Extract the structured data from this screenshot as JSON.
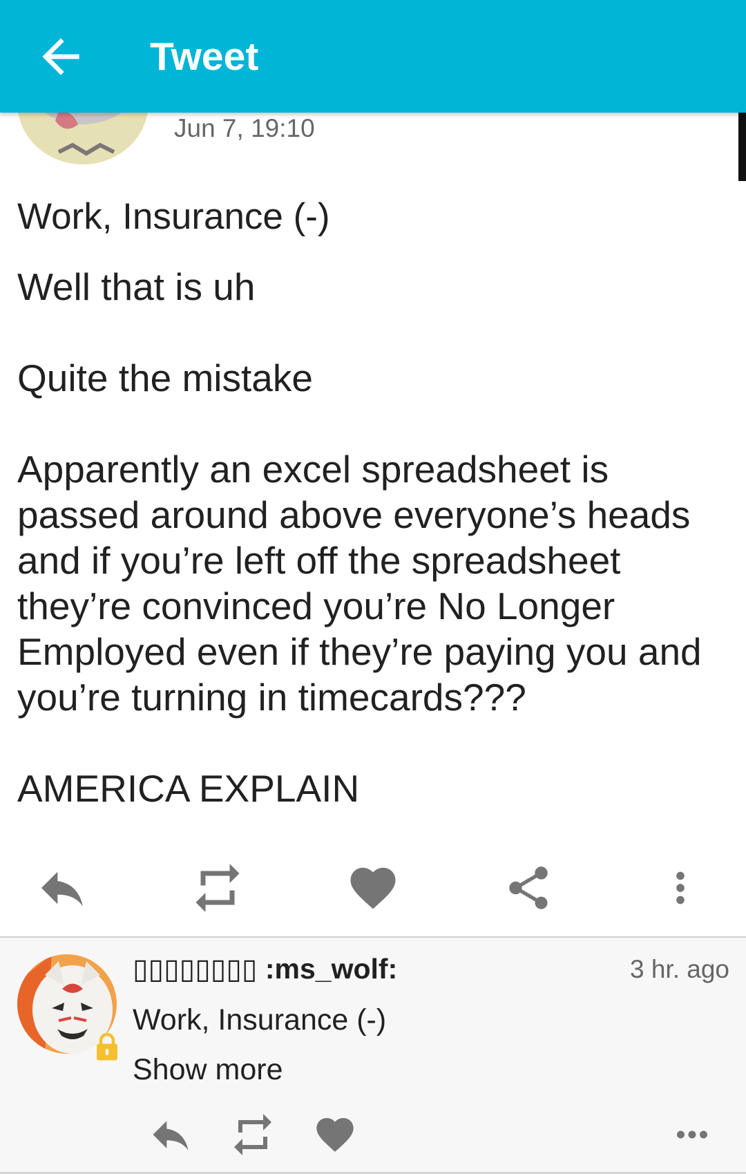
{
  "app_bar": {
    "title": "Tweet",
    "back_icon": "arrow-back-icon",
    "color": "#00b5d6"
  },
  "status": {
    "timestamp": "Jun 7, 19:10",
    "content_warning": "Work, Insurance (-)",
    "body": [
      "Well that is uh",
      "Quite the mistake",
      "Apparently an excel spreadsheet is passed around above everyone’s heads and if you’re left off the spreadsheet they’re convinced you’re No Longer Employed even if they’re paying you and you’re turning in timecards???",
      "AMERICA EXPLAIN"
    ],
    "actions": [
      "reply-icon",
      "boost-icon",
      "favourite-icon",
      "share-icon",
      "more-vert-icon"
    ]
  },
  "reply": {
    "display_name": "▯▯▯▯▯▯▯▯ :ms_wolf:",
    "time": "3 hr. ago",
    "content_warning": "Work, Insurance (-)",
    "show_more": "Show more",
    "locked_icon": "lock-icon",
    "actions": [
      "reply-icon",
      "boost-icon",
      "favourite-icon",
      "more-horiz-icon"
    ]
  },
  "colors": {
    "icon_gray": "#757575",
    "lock": "#f5c030",
    "text": "#212121",
    "secondary_text": "#666666"
  }
}
